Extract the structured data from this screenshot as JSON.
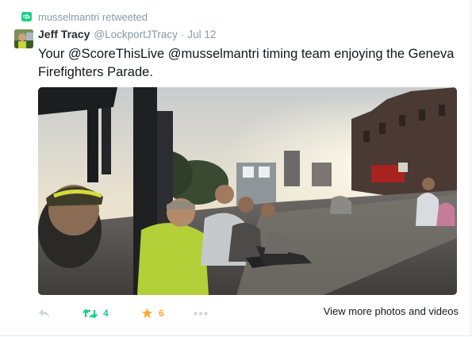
{
  "retweet_context": {
    "text": "musselmantri retweeted"
  },
  "author": {
    "name": "Jeff Tracy",
    "handle": "@LockportJTracy",
    "separator": "·",
    "date": "Jul 12"
  },
  "tweet": {
    "text": "Your @ScoreThisLive @musselmantri timing team enjoying the Geneva Firefighters Parade."
  },
  "media": {
    "alt": "Photo of timing team sitting on a curb watching the parade at sunset"
  },
  "actions": {
    "retweet_count": "4",
    "favorite_count": "6",
    "view_more_label": "View more photos and videos"
  },
  "colors": {
    "retweet": "#19cf86",
    "favorite": "#ffac33",
    "muted": "#8899a6",
    "text": "#14171a"
  },
  "icons": [
    "retweet-context-icon",
    "reply-icon",
    "retweet-icon",
    "favorite-icon",
    "more-icon"
  ]
}
